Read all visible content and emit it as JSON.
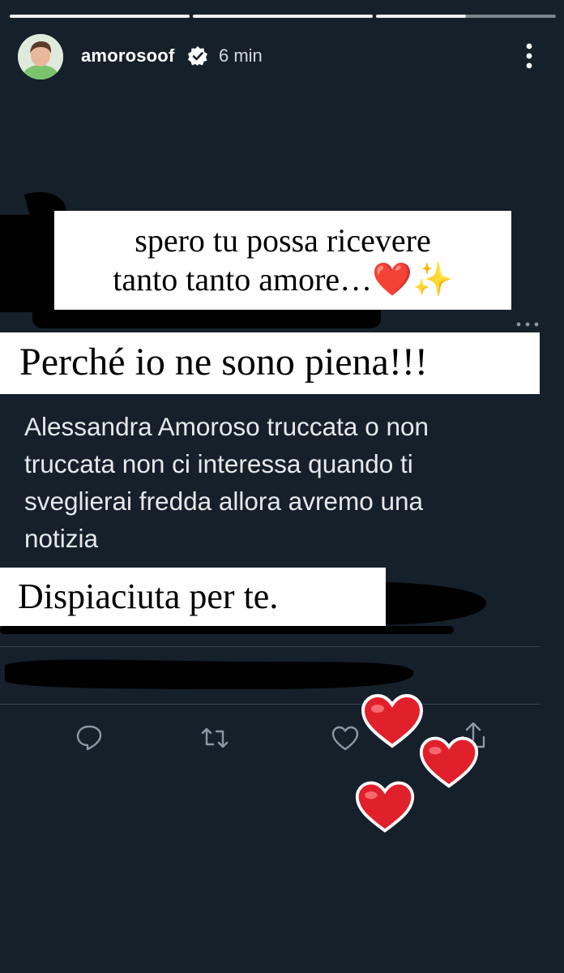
{
  "story": {
    "username": "amorosoof",
    "time": "6 min",
    "progress": [
      {
        "fraction": 1.0
      },
      {
        "fraction": 1.0
      },
      {
        "fraction": 0.5
      }
    ]
  },
  "captions": {
    "line1": "spero tu possa ricevere",
    "line2_text": "tanto tanto amore…",
    "line2_emoji": "❤️✨",
    "exclaim": "Perché io ne sono piena!!!",
    "sorry": "Dispiaciuta per te."
  },
  "tweet": {
    "text_line1": "Alessandra Amoroso truccata o non",
    "text_line2": "truccata non ci interessa quando ti",
    "text_line3": "sveglierai fredda allora avremo una",
    "text_line4": "notizia"
  },
  "icons": {
    "verified": "verified-badge-icon",
    "more": "more-vertical-icon",
    "reply": "reply-icon",
    "retweet": "retweet-icon",
    "like": "like-heart-icon",
    "share": "share-icon",
    "sticker": "red-heart-sticker-icon"
  },
  "colors": {
    "background": "#15202b",
    "tweet_text": "#e7e9ea",
    "action_icons": "#8b98a5",
    "heart_sticker": "#e0202b",
    "caption_box": "#ffffff"
  }
}
